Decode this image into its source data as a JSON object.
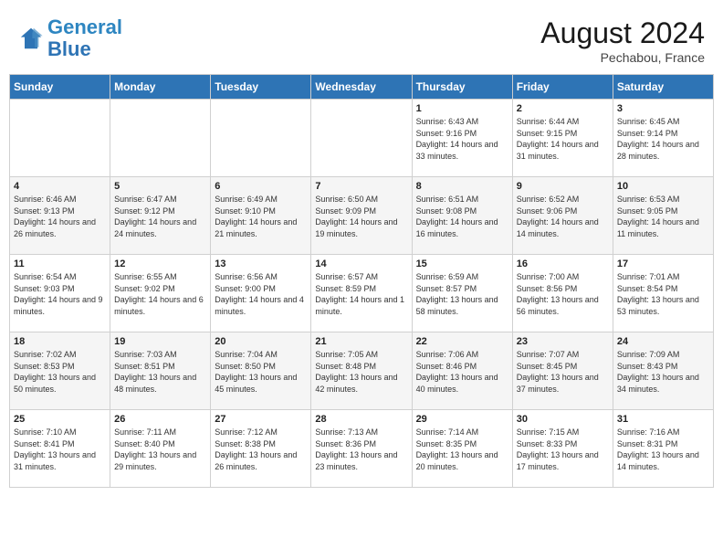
{
  "header": {
    "logo_line1": "General",
    "logo_line2": "Blue",
    "month_year": "August 2024",
    "location": "Pechabou, France"
  },
  "days_of_week": [
    "Sunday",
    "Monday",
    "Tuesday",
    "Wednesday",
    "Thursday",
    "Friday",
    "Saturday"
  ],
  "weeks": [
    [
      {
        "day": "",
        "sunrise": "",
        "sunset": "",
        "daylight": ""
      },
      {
        "day": "",
        "sunrise": "",
        "sunset": "",
        "daylight": ""
      },
      {
        "day": "",
        "sunrise": "",
        "sunset": "",
        "daylight": ""
      },
      {
        "day": "",
        "sunrise": "",
        "sunset": "",
        "daylight": ""
      },
      {
        "day": "1",
        "sunrise": "Sunrise: 6:43 AM",
        "sunset": "Sunset: 9:16 PM",
        "daylight": "Daylight: 14 hours and 33 minutes."
      },
      {
        "day": "2",
        "sunrise": "Sunrise: 6:44 AM",
        "sunset": "Sunset: 9:15 PM",
        "daylight": "Daylight: 14 hours and 31 minutes."
      },
      {
        "day": "3",
        "sunrise": "Sunrise: 6:45 AM",
        "sunset": "Sunset: 9:14 PM",
        "daylight": "Daylight: 14 hours and 28 minutes."
      }
    ],
    [
      {
        "day": "4",
        "sunrise": "Sunrise: 6:46 AM",
        "sunset": "Sunset: 9:13 PM",
        "daylight": "Daylight: 14 hours and 26 minutes."
      },
      {
        "day": "5",
        "sunrise": "Sunrise: 6:47 AM",
        "sunset": "Sunset: 9:12 PM",
        "daylight": "Daylight: 14 hours and 24 minutes."
      },
      {
        "day": "6",
        "sunrise": "Sunrise: 6:49 AM",
        "sunset": "Sunset: 9:10 PM",
        "daylight": "Daylight: 14 hours and 21 minutes."
      },
      {
        "day": "7",
        "sunrise": "Sunrise: 6:50 AM",
        "sunset": "Sunset: 9:09 PM",
        "daylight": "Daylight: 14 hours and 19 minutes."
      },
      {
        "day": "8",
        "sunrise": "Sunrise: 6:51 AM",
        "sunset": "Sunset: 9:08 PM",
        "daylight": "Daylight: 14 hours and 16 minutes."
      },
      {
        "day": "9",
        "sunrise": "Sunrise: 6:52 AM",
        "sunset": "Sunset: 9:06 PM",
        "daylight": "Daylight: 14 hours and 14 minutes."
      },
      {
        "day": "10",
        "sunrise": "Sunrise: 6:53 AM",
        "sunset": "Sunset: 9:05 PM",
        "daylight": "Daylight: 14 hours and 11 minutes."
      }
    ],
    [
      {
        "day": "11",
        "sunrise": "Sunrise: 6:54 AM",
        "sunset": "Sunset: 9:03 PM",
        "daylight": "Daylight: 14 hours and 9 minutes."
      },
      {
        "day": "12",
        "sunrise": "Sunrise: 6:55 AM",
        "sunset": "Sunset: 9:02 PM",
        "daylight": "Daylight: 14 hours and 6 minutes."
      },
      {
        "day": "13",
        "sunrise": "Sunrise: 6:56 AM",
        "sunset": "Sunset: 9:00 PM",
        "daylight": "Daylight: 14 hours and 4 minutes."
      },
      {
        "day": "14",
        "sunrise": "Sunrise: 6:57 AM",
        "sunset": "Sunset: 8:59 PM",
        "daylight": "Daylight: 14 hours and 1 minute."
      },
      {
        "day": "15",
        "sunrise": "Sunrise: 6:59 AM",
        "sunset": "Sunset: 8:57 PM",
        "daylight": "Daylight: 13 hours and 58 minutes."
      },
      {
        "day": "16",
        "sunrise": "Sunrise: 7:00 AM",
        "sunset": "Sunset: 8:56 PM",
        "daylight": "Daylight: 13 hours and 56 minutes."
      },
      {
        "day": "17",
        "sunrise": "Sunrise: 7:01 AM",
        "sunset": "Sunset: 8:54 PM",
        "daylight": "Daylight: 13 hours and 53 minutes."
      }
    ],
    [
      {
        "day": "18",
        "sunrise": "Sunrise: 7:02 AM",
        "sunset": "Sunset: 8:53 PM",
        "daylight": "Daylight: 13 hours and 50 minutes."
      },
      {
        "day": "19",
        "sunrise": "Sunrise: 7:03 AM",
        "sunset": "Sunset: 8:51 PM",
        "daylight": "Daylight: 13 hours and 48 minutes."
      },
      {
        "day": "20",
        "sunrise": "Sunrise: 7:04 AM",
        "sunset": "Sunset: 8:50 PM",
        "daylight": "Daylight: 13 hours and 45 minutes."
      },
      {
        "day": "21",
        "sunrise": "Sunrise: 7:05 AM",
        "sunset": "Sunset: 8:48 PM",
        "daylight": "Daylight: 13 hours and 42 minutes."
      },
      {
        "day": "22",
        "sunrise": "Sunrise: 7:06 AM",
        "sunset": "Sunset: 8:46 PM",
        "daylight": "Daylight: 13 hours and 40 minutes."
      },
      {
        "day": "23",
        "sunrise": "Sunrise: 7:07 AM",
        "sunset": "Sunset: 8:45 PM",
        "daylight": "Daylight: 13 hours and 37 minutes."
      },
      {
        "day": "24",
        "sunrise": "Sunrise: 7:09 AM",
        "sunset": "Sunset: 8:43 PM",
        "daylight": "Daylight: 13 hours and 34 minutes."
      }
    ],
    [
      {
        "day": "25",
        "sunrise": "Sunrise: 7:10 AM",
        "sunset": "Sunset: 8:41 PM",
        "daylight": "Daylight: 13 hours and 31 minutes."
      },
      {
        "day": "26",
        "sunrise": "Sunrise: 7:11 AM",
        "sunset": "Sunset: 8:40 PM",
        "daylight": "Daylight: 13 hours and 29 minutes."
      },
      {
        "day": "27",
        "sunrise": "Sunrise: 7:12 AM",
        "sunset": "Sunset: 8:38 PM",
        "daylight": "Daylight: 13 hours and 26 minutes."
      },
      {
        "day": "28",
        "sunrise": "Sunrise: 7:13 AM",
        "sunset": "Sunset: 8:36 PM",
        "daylight": "Daylight: 13 hours and 23 minutes."
      },
      {
        "day": "29",
        "sunrise": "Sunrise: 7:14 AM",
        "sunset": "Sunset: 8:35 PM",
        "daylight": "Daylight: 13 hours and 20 minutes."
      },
      {
        "day": "30",
        "sunrise": "Sunrise: 7:15 AM",
        "sunset": "Sunset: 8:33 PM",
        "daylight": "Daylight: 13 hours and 17 minutes."
      },
      {
        "day": "31",
        "sunrise": "Sunrise: 7:16 AM",
        "sunset": "Sunset: 8:31 PM",
        "daylight": "Daylight: 13 hours and 14 minutes."
      }
    ]
  ]
}
